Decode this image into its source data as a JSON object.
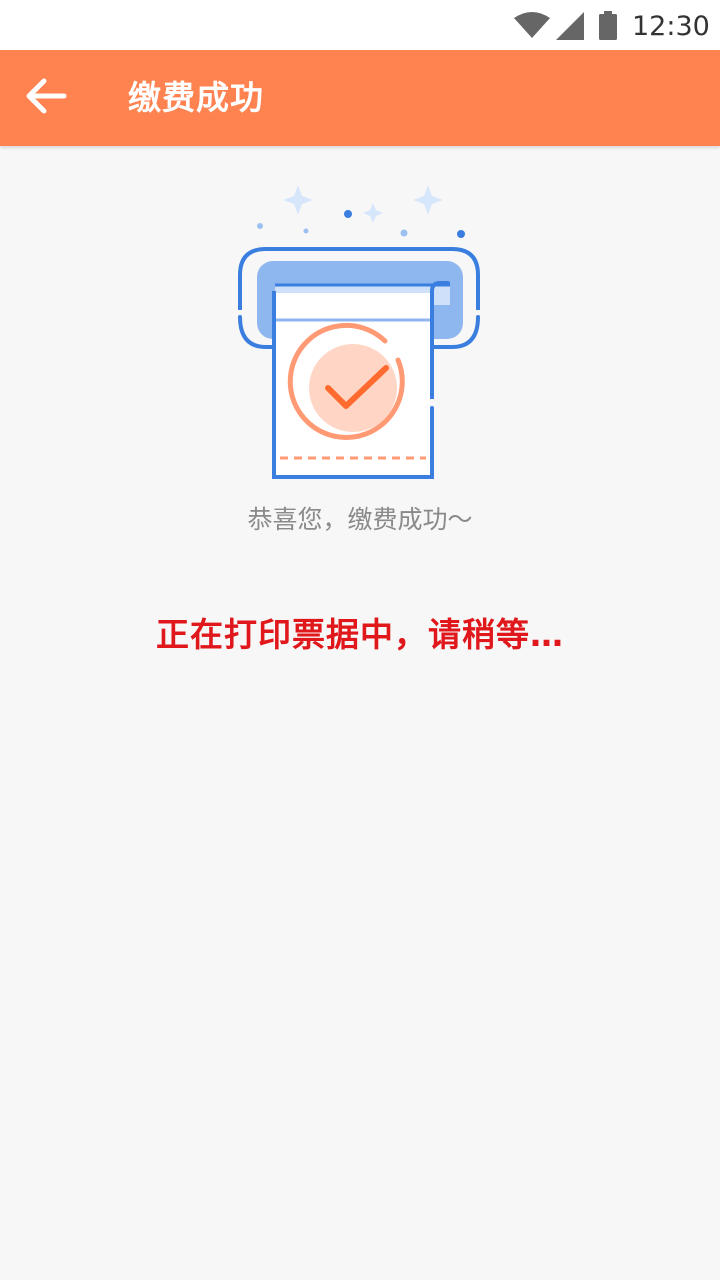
{
  "status_bar": {
    "time": "12:30",
    "wifi_icon": "wifi-icon",
    "signal_icon": "signal-icon",
    "battery_icon": "battery-icon"
  },
  "app_bar": {
    "back_icon": "back-arrow-icon",
    "title": "缴费成功",
    "color": "#ff8350"
  },
  "illustration": {
    "icon": "receipt-printer-success-icon"
  },
  "message": {
    "congrats": "恭喜您，缴费成功～",
    "printing": "正在打印票据中，请稍等…",
    "printing_color": "#e0181c"
  }
}
